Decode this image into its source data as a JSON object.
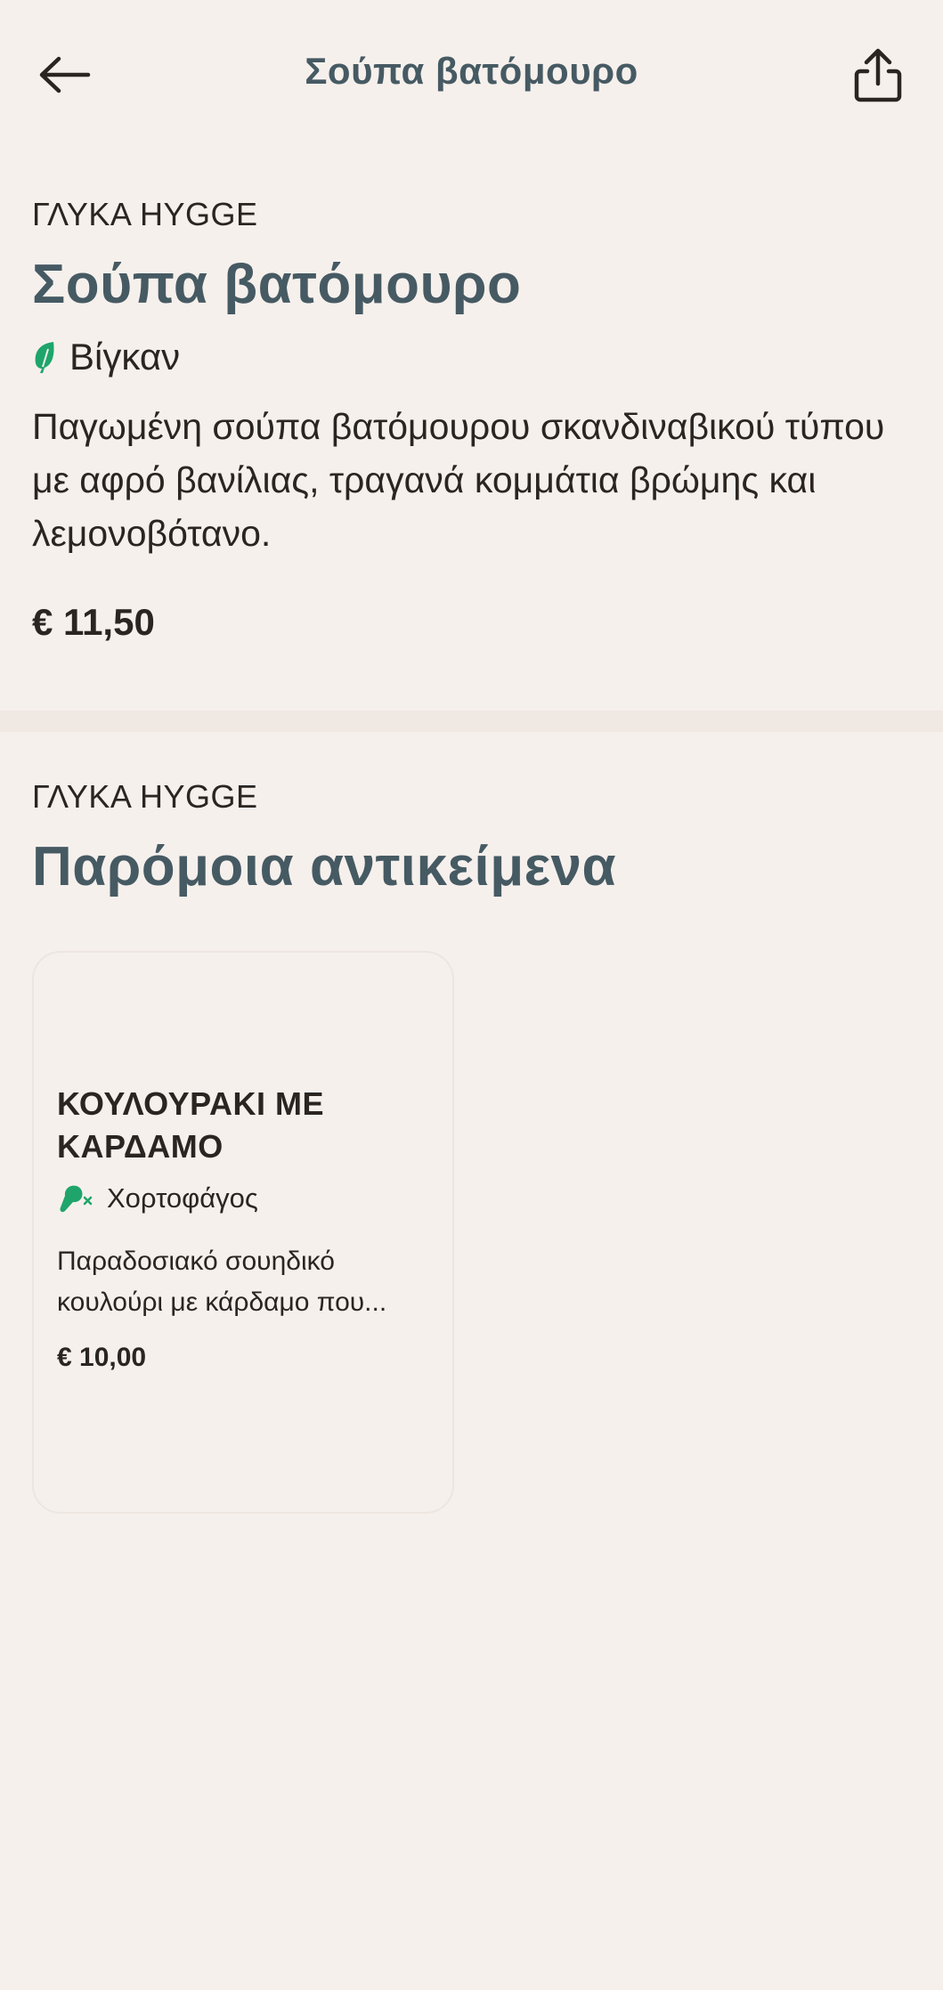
{
  "header": {
    "title": "Σούπα βατόμουρο",
    "back_icon": "arrow-left-icon",
    "share_icon": "share-icon"
  },
  "product": {
    "category": "ΓΛΥΚΑ HYGGE",
    "title": "Σούπα βατόμουρο",
    "diet_label": "Βίγκαν",
    "diet_icon": "leaf-icon",
    "description": "Παγωμένη σούπα βατόμουρου σκανδιναβικού τύπου με αφρό βανίλιας, τραγανά κομμάτια βρώμης και λεμονοβότανο.",
    "price": "€ 11,50"
  },
  "similar": {
    "category": "ΓΛΥΚΑ HYGGE",
    "title": "Παρόμοια αντικείμενα",
    "items": [
      {
        "title": "ΚΟΥΛΟΥΡΑΚΙ ΜΕ ΚΑΡΔΑΜΟ",
        "diet_label": "Χορτοφάγος",
        "diet_icon": "vegetarian-icon",
        "description_line1": "Παραδοσιακό σουηδικό",
        "description_line2": "κουλούρι με κάρδαμο που...",
        "price": "€ 10,00"
      }
    ]
  },
  "colors": {
    "background": "#f6f0ec",
    "heading": "#465a63",
    "text": "#2b2522",
    "diet_green": "#1fa56b",
    "divider": "#efe8e3"
  }
}
